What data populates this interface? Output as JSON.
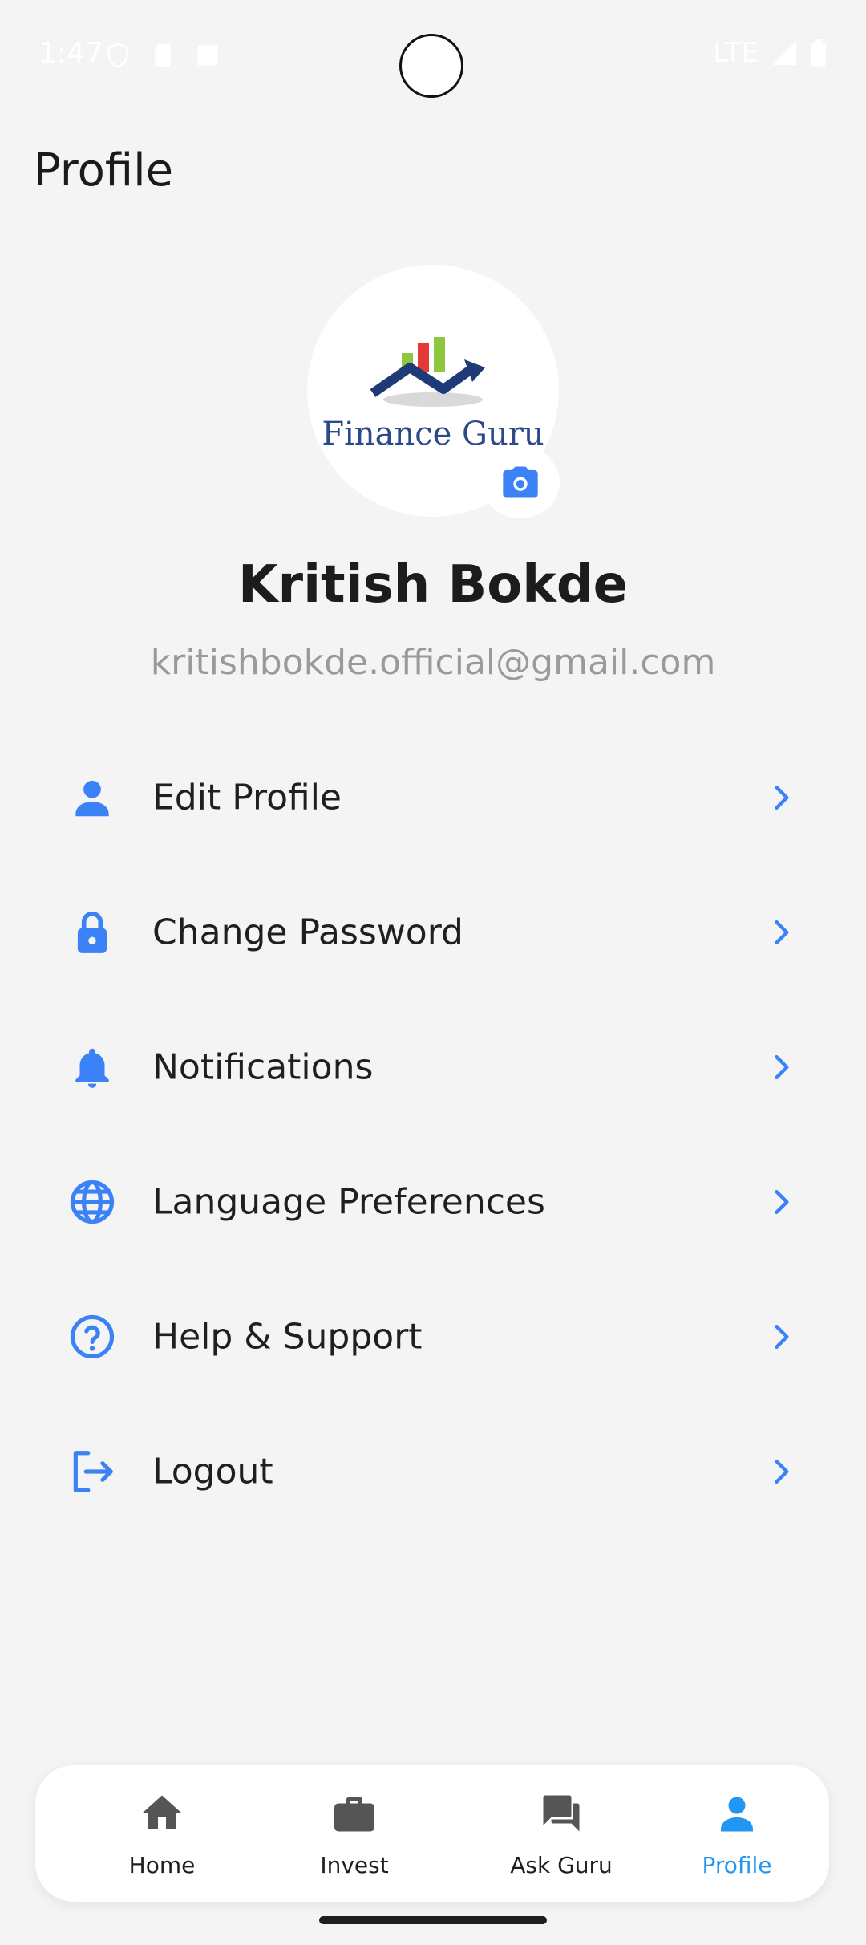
{
  "status_bar": {
    "time": "1:47",
    "network": "LTE"
  },
  "header": {
    "title": "Profile"
  },
  "profile": {
    "logo_text": "Finance Guru",
    "name": "Kritish Bokde",
    "email": "kritishbokde.official@gmail.com"
  },
  "menu": {
    "items": [
      {
        "label": "Edit Profile",
        "icon": "person-icon"
      },
      {
        "label": "Change Password",
        "icon": "lock-icon"
      },
      {
        "label": "Notifications",
        "icon": "bell-icon"
      },
      {
        "label": "Language Preferences",
        "icon": "globe-icon"
      },
      {
        "label": "Help & Support",
        "icon": "help-circle-icon"
      },
      {
        "label": "Logout",
        "icon": "logout-icon"
      }
    ]
  },
  "bottom_nav": {
    "items": [
      {
        "label": "Home",
        "icon": "home-icon",
        "active": false
      },
      {
        "label": "Invest",
        "icon": "briefcase-icon",
        "active": false
      },
      {
        "label": "Ask Guru",
        "icon": "chat-icon",
        "active": false
      },
      {
        "label": "Profile",
        "icon": "person-icon",
        "active": true
      }
    ]
  },
  "colors": {
    "accent": "#3b82f6",
    "nav_active": "#2196f3",
    "nav_inactive": "#555555",
    "background": "#f4f4f5"
  }
}
